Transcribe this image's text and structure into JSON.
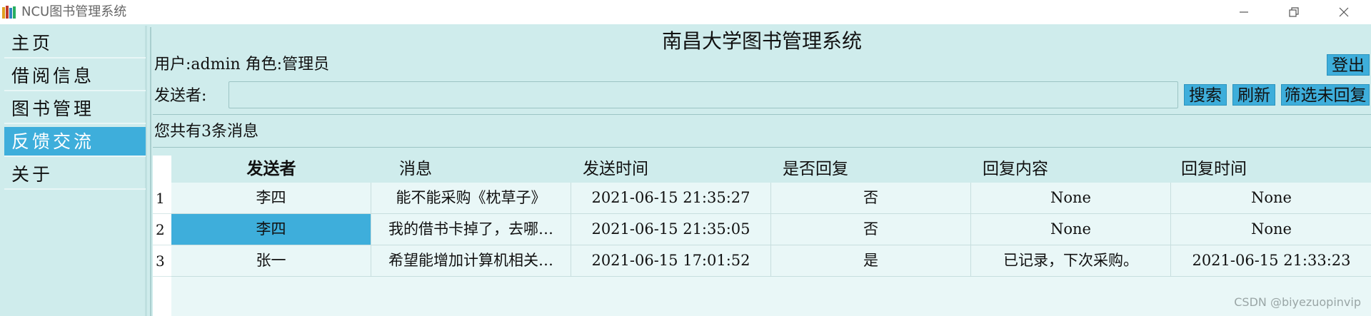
{
  "window": {
    "title": "NCU图书管理系统",
    "icon": "books-icon",
    "controls": [
      "minimize-icon",
      "restore-icon",
      "close-icon"
    ]
  },
  "sidebar": {
    "items": [
      {
        "label": "主页",
        "active": false
      },
      {
        "label": "借阅信息",
        "active": false
      },
      {
        "label": "图书管理",
        "active": false
      },
      {
        "label": "反馈交流",
        "active": true
      },
      {
        "label": "关于",
        "active": false
      }
    ]
  },
  "header": {
    "system_title": "南昌大学图书管理系统",
    "user_info": "用户:admin 角色:管理员",
    "logout_label": "登出"
  },
  "search": {
    "sender_label": "发送者:",
    "sender_value": "",
    "search_label": "搜索",
    "refresh_label": "刷新",
    "filter_label": "筛选未回复"
  },
  "messages": {
    "count_text": "您共有3条消息",
    "columns": [
      "发送者",
      "消息",
      "发送时间",
      "是否回复",
      "回复内容",
      "回复时间"
    ],
    "rows": [
      {
        "num": "1",
        "sender": "李四",
        "message": "能不能采购《枕草子》",
        "sent_time": "2021-06-15 21:35:27",
        "replied": "否",
        "reply_content": "None",
        "reply_time": "None"
      },
      {
        "num": "2",
        "sender": "李四",
        "message": "我的借书卡掉了，去哪…",
        "sent_time": "2021-06-15 21:35:05",
        "replied": "否",
        "reply_content": "None",
        "reply_time": "None"
      },
      {
        "num": "3",
        "sender": "张一",
        "message": "希望能增加计算机相关…",
        "sent_time": "2021-06-15 17:01:52",
        "replied": "是",
        "reply_content": "已记录，下次采购。",
        "reply_time": "2021-06-15 21:33:23"
      }
    ]
  },
  "watermark": "CSDN @biyezuopinvip",
  "colors": {
    "background": "#cfecec",
    "accent": "#3eaedb",
    "table_bg": "#e9f7f7"
  }
}
